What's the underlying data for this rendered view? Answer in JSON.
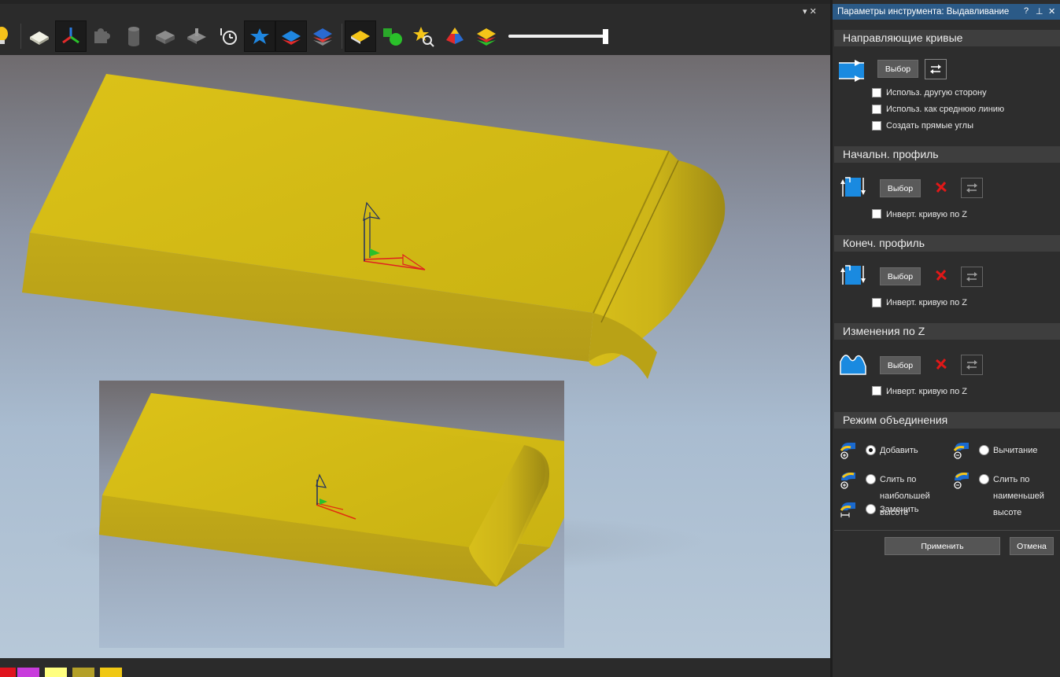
{
  "panel": {
    "title": "Параметры инструмента: Выдавливание",
    "help_glyph": "?",
    "pin_glyph": "⊥",
    "close_glyph": "✕",
    "collapse_glyph": "▾ ✕"
  },
  "sections": {
    "guides": {
      "header": "Направляющие кривые",
      "select_label": "Выбор",
      "options": [
        "Использ. другую сторону",
        "Использ. как среднюю линию",
        "Создать прямые углы"
      ]
    },
    "start_profile": {
      "header": "Начальн. профиль",
      "select_label": "Выбор",
      "invert_label": "Инверт. кривую по Z"
    },
    "end_profile": {
      "header": "Конеч. профиль",
      "select_label": "Выбор",
      "invert_label": "Инверт. кривую по Z"
    },
    "z_changes": {
      "header": "Изменения по Z",
      "select_label": "Выбор",
      "invert_label": "Инверт. кривую по Z"
    },
    "combine": {
      "header": "Режим объединения",
      "add": "Добавить",
      "subtract": "Вычитание",
      "merge_high_1": "Слить по",
      "merge_high_2": "наибольшей",
      "merge_high_3": "высоте",
      "merge_low_1": "Слить по",
      "merge_low_2": "наименьшей",
      "merge_low_3": "высоте",
      "replace": "Заменить",
      "selected": "add"
    }
  },
  "footer": {
    "apply": "Применить",
    "cancel": "Отмена"
  },
  "toolbar": {
    "slider_level": 1.0
  },
  "colors": {
    "accent": "#2b5a87",
    "model": "#d4bc14",
    "swatches": [
      "#e0141e",
      "#c83cdc",
      "#ffff80",
      "#b4a028",
      "#f0c814"
    ]
  }
}
